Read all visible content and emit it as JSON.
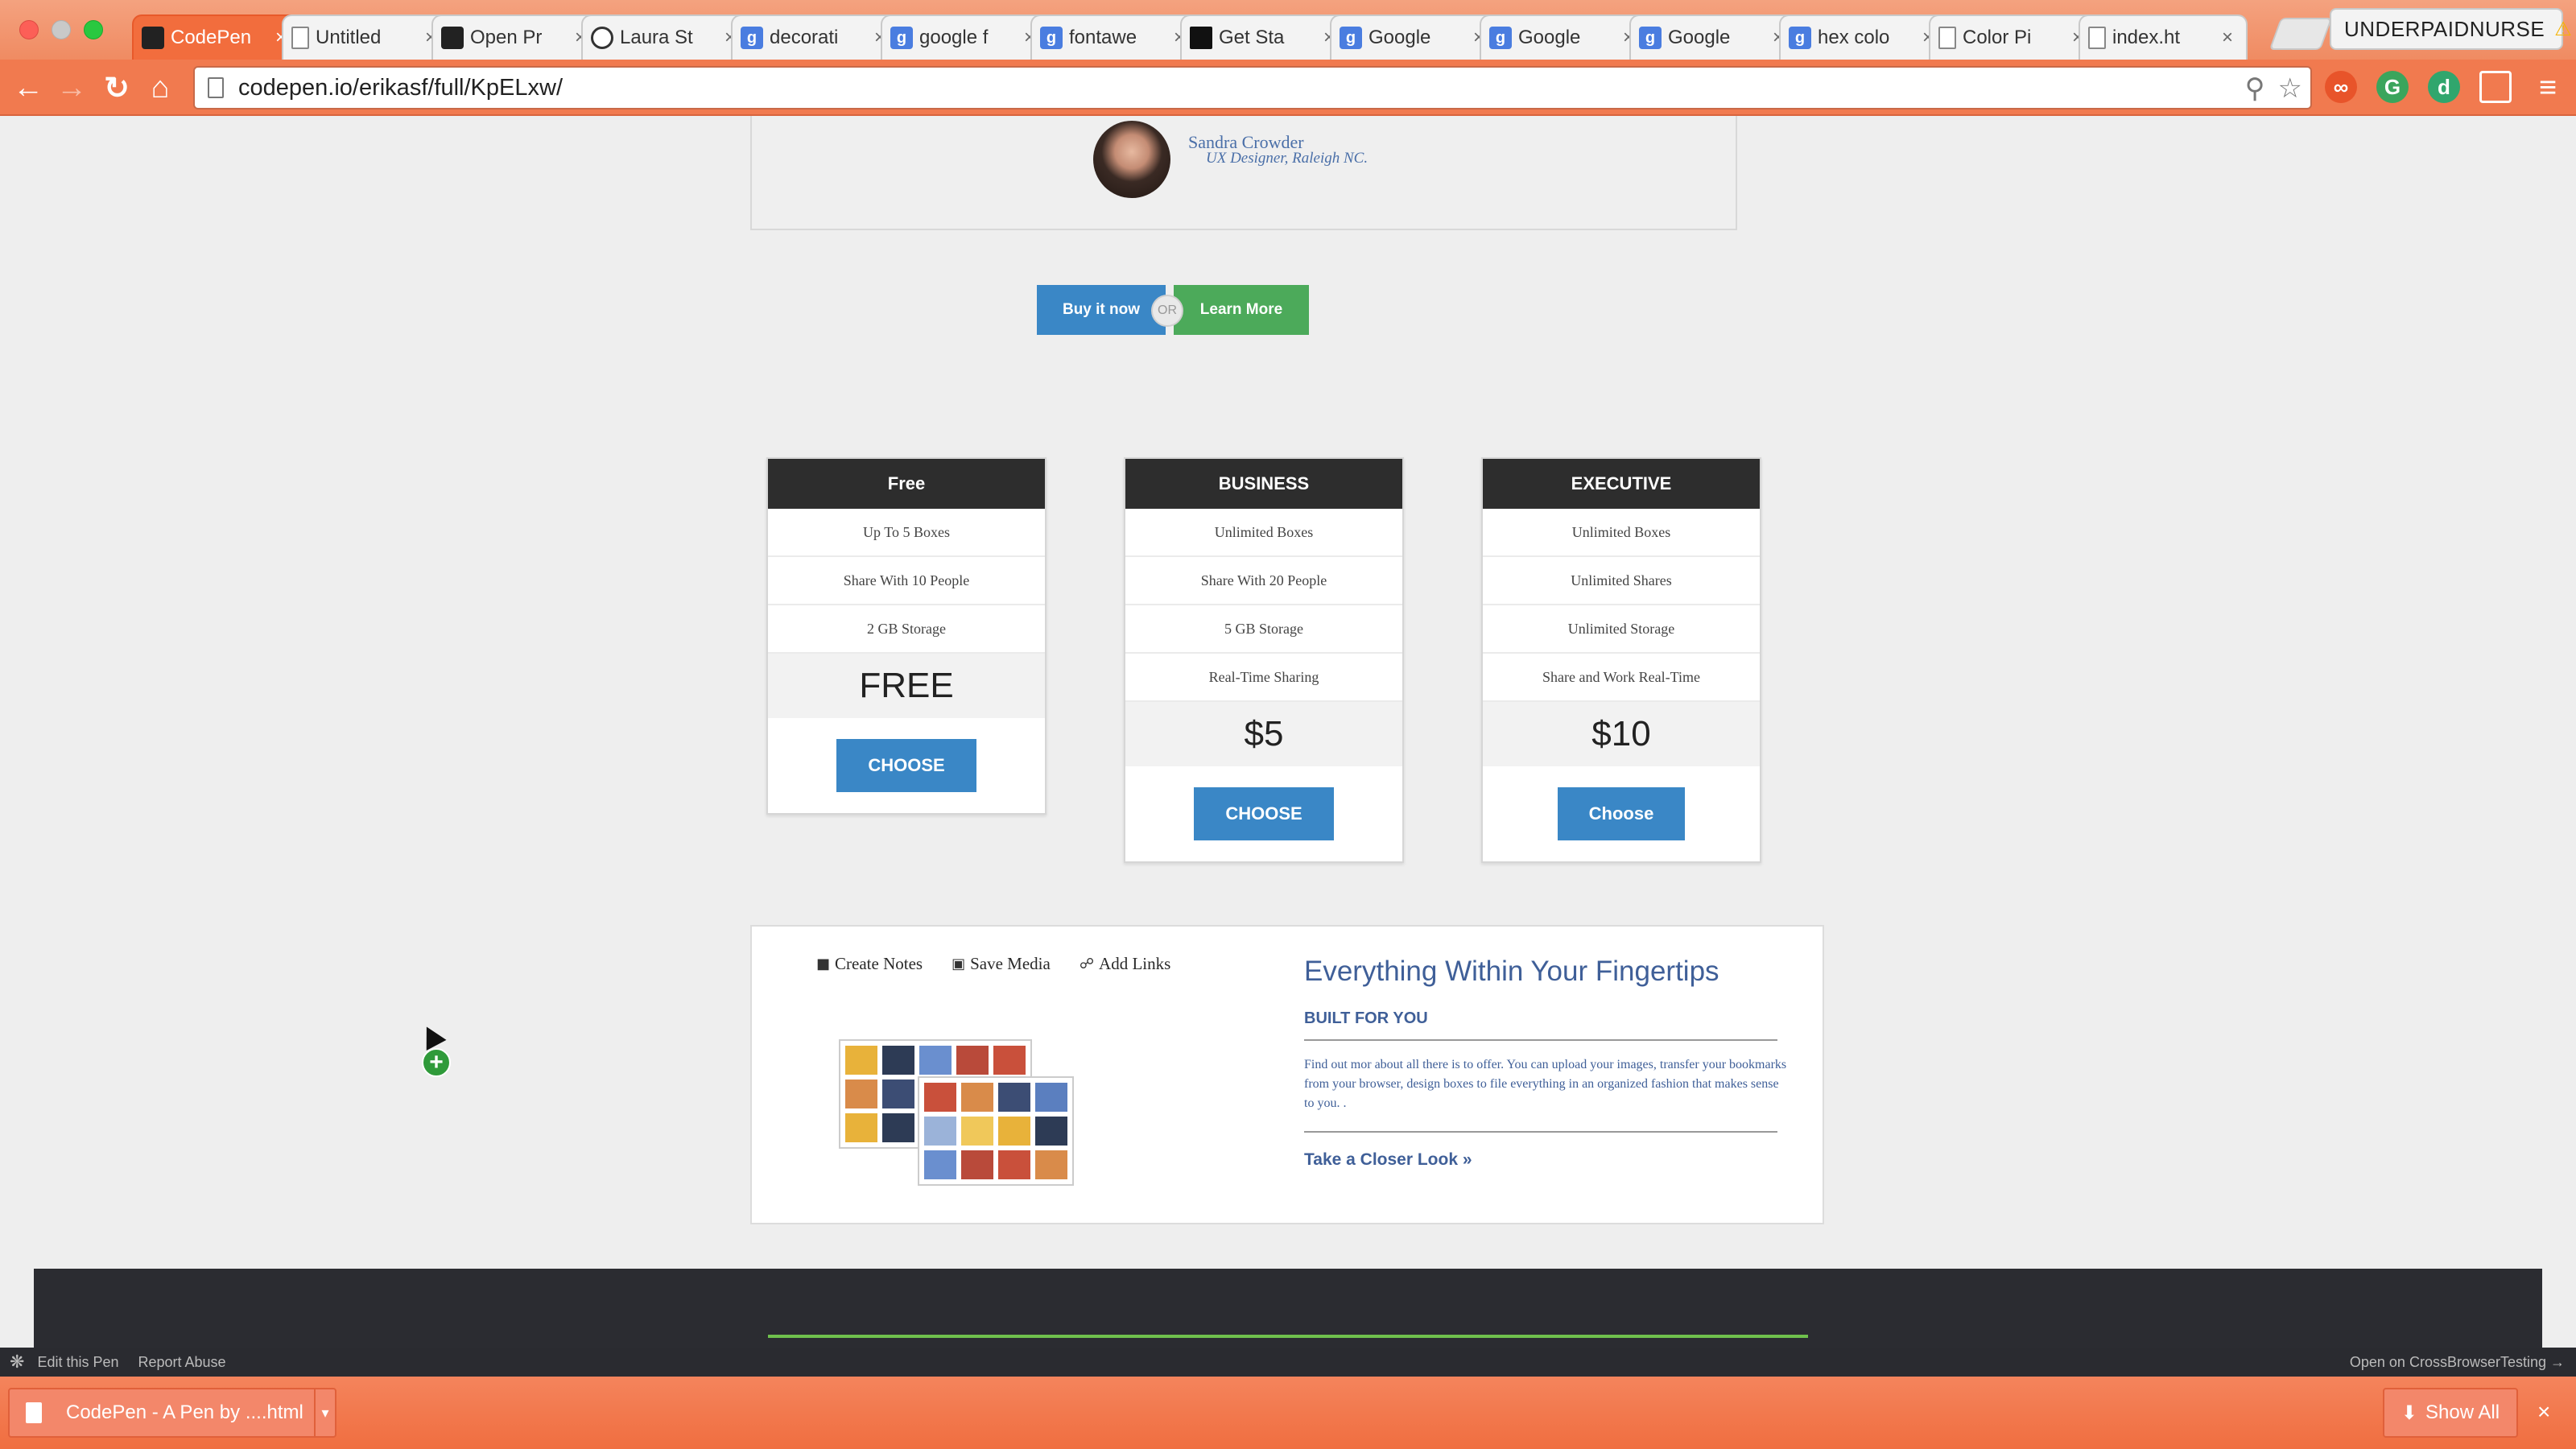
{
  "browser": {
    "tabs": [
      {
        "title": "CodePen",
        "icon": "codepen-icon",
        "active": true
      },
      {
        "title": "Untitled",
        "icon": "doc-icon"
      },
      {
        "title": "Open Pr",
        "icon": "open-icon"
      },
      {
        "title": "Laura St",
        "icon": "circle-icon"
      },
      {
        "title": "decorati",
        "icon": "google-icon"
      },
      {
        "title": "google f",
        "icon": "google-icon"
      },
      {
        "title": "fontawe",
        "icon": "google-icon"
      },
      {
        "title": "Get Sta",
        "icon": "mail-icon"
      },
      {
        "title": "Google",
        "icon": "google-icon"
      },
      {
        "title": "Google",
        "icon": "google-icon"
      },
      {
        "title": "Google",
        "icon": "google-icon"
      },
      {
        "title": "hex colo",
        "icon": "google-icon"
      },
      {
        "title": "Color Pi",
        "icon": "doc-icon"
      },
      {
        "title": "index.ht",
        "icon": "doc-icon"
      }
    ],
    "profile_name": "UNDERPAIDNURSE",
    "url": "codepen.io/erikasf/full/KpELxw/",
    "icons": {
      "back": "←",
      "forward": "→",
      "reload": "↻",
      "home": "⌂",
      "search": "⚲",
      "star": "☆",
      "menu": "≡",
      "warn": "⚠"
    }
  },
  "page": {
    "testimonial": {
      "name": "Sandra Crowder",
      "role": "UX Designer, Raleigh NC."
    },
    "cta": {
      "buy_label": "Buy it now",
      "or_label": "OR",
      "learn_label": "Learn More"
    },
    "plans": [
      {
        "name": "Free",
        "features": [
          "Up To 5 Boxes",
          "Share With 10 People",
          "2 GB Storage"
        ],
        "price": "FREE",
        "button": "CHOOSE"
      },
      {
        "name": "BUSINESS",
        "features": [
          "Unlimited Boxes",
          "Share With 20 People",
          "5 GB Storage",
          "Real-Time Sharing"
        ],
        "price": "$5",
        "button": "CHOOSE"
      },
      {
        "name": "EXECUTIVE",
        "features": [
          "Unlimited Boxes",
          "Unlimited Shares",
          "Unlimited Storage",
          "Share and Work Real-Time"
        ],
        "price": "$10",
        "button": "Choose"
      }
    ],
    "features_panel": {
      "tabs": [
        {
          "label": "Create Notes",
          "icon": "■"
        },
        {
          "label": "Save Media",
          "icon": "▣"
        },
        {
          "label": "Add Links",
          "icon": "☍"
        }
      ],
      "title": "Everything Within Your Fingertips",
      "subtitle": "BUILT FOR YOU",
      "body": "Find out mor about all there is to offer. You can upload your images, transfer your bookmarks from your browser, design boxes to file everything in an organized fashion that makes sense to you. .",
      "link": "Take a Closer Look »"
    }
  },
  "codepen_bar": {
    "edit": "Edit this Pen",
    "report": "Report Abuse",
    "open": "Open on CrossBrowserTesting →"
  },
  "downloads": {
    "file": "CodePen - A Pen by ....html",
    "show_all": "Show All",
    "close": "×"
  },
  "colors": {
    "chrome_orange": "#f17a4f",
    "button_blue": "#3a87c6",
    "button_green": "#4caa5a",
    "text_blue": "#3f5f98",
    "plan_header": "#2d2d2d",
    "footer_dark": "#2b2c31",
    "footer_accent": "#6fc04d"
  }
}
